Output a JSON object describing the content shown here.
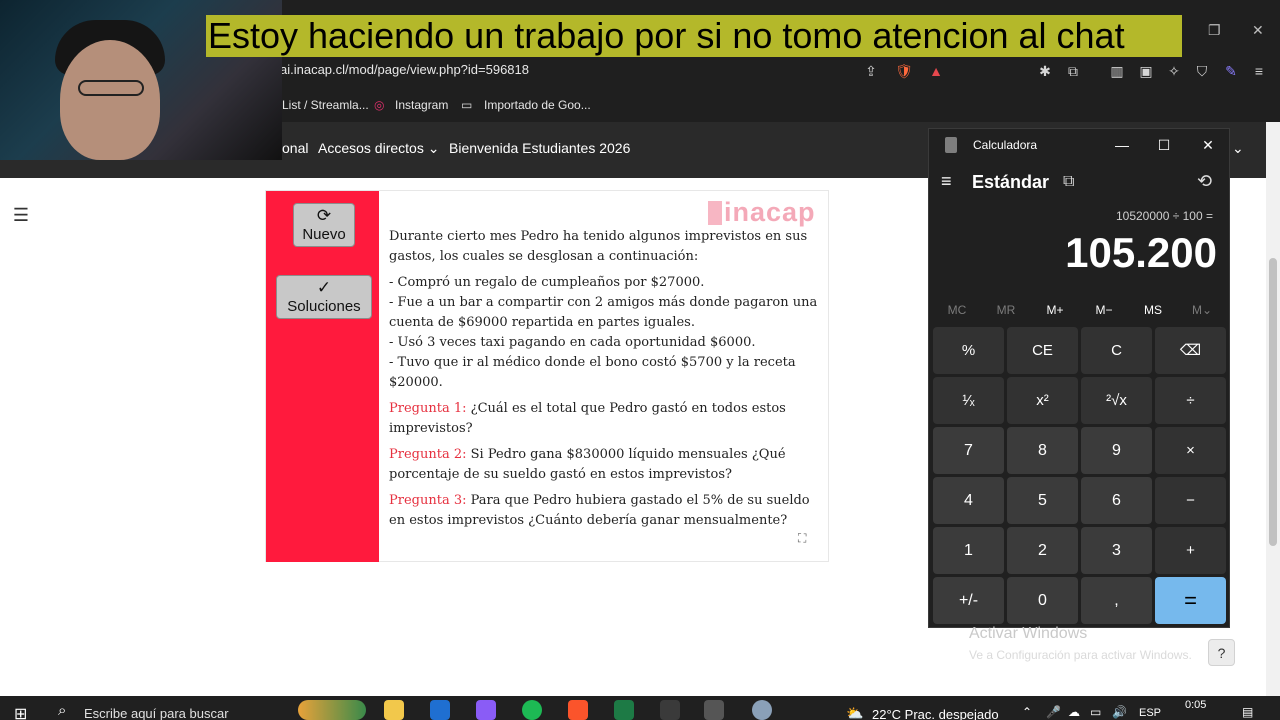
{
  "caption": "Estoy haciendo un trabajo por si no tomo atencion al chat",
  "browser": {
    "url": "ai.inacap.cl/mod/page/view.php?id=596818",
    "bookmarks": [
      "List / Streamla...",
      "Instagram",
      "Importado de Goo..."
    ],
    "site_nav": [
      "onal",
      "Accesos directos",
      "Bienvenida Estudiantes 2026"
    ]
  },
  "activity": {
    "buttons": {
      "new": "Nuevo",
      "solutions": "Soluciones"
    },
    "logo": "inacap",
    "intro": "Durante cierto mes Pedro ha tenido algunos imprevistos en sus gastos, los cuales se desglosan a continuación:",
    "items": [
      "- Compró un regalo de cumpleaños por $27000.",
      "- Fue a un bar a compartir con 2 amigos más donde pagaron una cuenta de $69000 repartida en partes iguales.",
      "- Usó 3 veces taxi pagando en cada oportunidad $6000.",
      "- Tuvo que ir al médico donde el bono costó $5700 y la receta $20000."
    ],
    "questions": [
      {
        "label": "Pregunta 1:",
        "text": "¿Cuál es el total que Pedro gastó en todos estos imprevistos?"
      },
      {
        "label": "Pregunta 2:",
        "text": "Si Pedro gana $830000 líquido mensuales ¿Qué porcentaje de su sueldo gastó en estos imprevistos?"
      },
      {
        "label": "Pregunta 3:",
        "text": "Para que Pedro hubiera gastado el 5% de su sueldo en estos imprevistos ¿Cuánto debería ganar mensualmente?"
      }
    ]
  },
  "calculator": {
    "title": "Calculadora",
    "mode": "Estándar",
    "expression": "10520000 ÷ 100 =",
    "display": "105.200",
    "memory": [
      "MC",
      "MR",
      "M+",
      "M−",
      "MS",
      "M⌄"
    ],
    "keys": [
      [
        "%",
        "CE",
        "C",
        "⌫"
      ],
      [
        "¹⁄ₓ",
        "x²",
        "²√x",
        "÷"
      ],
      [
        "7",
        "8",
        "9",
        "×"
      ],
      [
        "4",
        "5",
        "6",
        "−"
      ],
      [
        "1",
        "2",
        "3",
        "+"
      ],
      [
        "+/-",
        "0",
        ",",
        "="
      ]
    ]
  },
  "watermark": {
    "title": "Activar Windows",
    "subtitle": "Ve a Configuración para activar Windows."
  },
  "help_label": "?",
  "taskbar": {
    "search_placeholder": "Escribe aquí para buscar",
    "weather": "22°C  Prac. despejado",
    "language": "ESP",
    "time": "0:05"
  },
  "colors": {
    "inacap_red": "#ff1a3d",
    "question_red": "#e6303f",
    "caption_bg": "#b4b82a",
    "equals_blue": "#76b9ed"
  }
}
